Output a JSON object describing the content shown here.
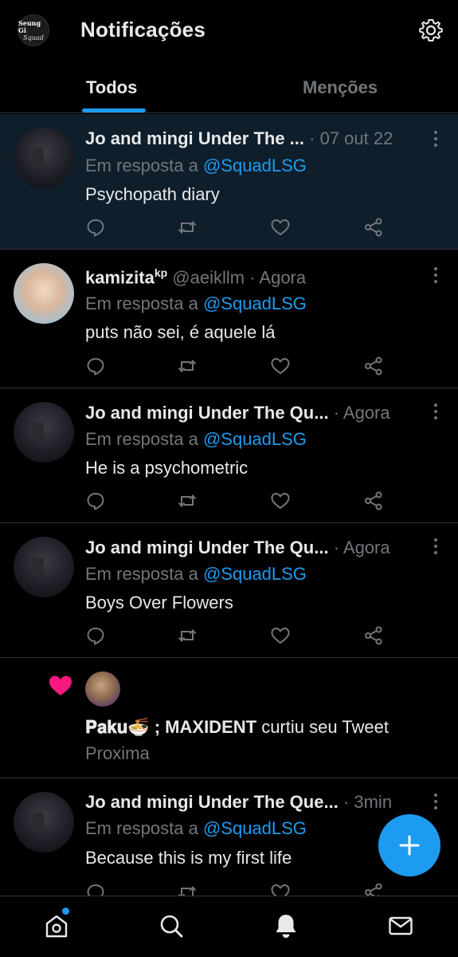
{
  "header": {
    "title": "Notificações",
    "avatar_line1": "Seung Gi",
    "avatar_line2": "Squad"
  },
  "tabs": [
    {
      "label": "Todos",
      "active": true
    },
    {
      "label": "Menções",
      "active": false
    }
  ],
  "notifications": [
    {
      "type": "reply",
      "name": "Jo and mingi Under The ...",
      "meta": " · 07 out 22",
      "reply_prefix": "Em resposta a ",
      "reply_handle": "@SquadLSG",
      "text": "Psychopath diary"
    },
    {
      "type": "reply",
      "name": "kamizita",
      "name_sup": "kp",
      "meta": " @aeikllm · Agora",
      "reply_prefix": "Em resposta a ",
      "reply_handle": "@SquadLSG",
      "text": "puts não sei, é aquele lá"
    },
    {
      "type": "reply",
      "name": "Jo and mingi Under The Qu...",
      "meta": " · Agora",
      "reply_prefix": "Em resposta a ",
      "reply_handle": "@SquadLSG",
      "text": "He is a psychometric"
    },
    {
      "type": "reply",
      "name": "Jo and mingi Under The Qu...",
      "meta": " · Agora",
      "reply_prefix": "Em resposta a ",
      "reply_handle": "@SquadLSG",
      "text": "Boys Over Flowers"
    },
    {
      "type": "like",
      "name": "𝐏𝐚𝐤𝐮🍜 ; MAXIDENT",
      "action": " curtiu seu Tweet",
      "sub": "Proxima"
    },
    {
      "type": "reply",
      "name": "Jo and mingi Under The Que...",
      "meta": " · 3min",
      "reply_prefix": "Em resposta a ",
      "reply_handle": "@SquadLSG",
      "text": "Because this is my first life"
    }
  ],
  "colors": {
    "accent": "#1d9bf0",
    "heart": "#f91880",
    "muted": "#71767b",
    "text": "#e7e9ea",
    "highlight_bg": "#0f1e2b"
  },
  "icons": [
    "gear-icon",
    "reply-icon",
    "retweet-icon",
    "like-icon",
    "share-icon",
    "more-icon",
    "heart-icon",
    "plus-icon",
    "home-icon",
    "search-icon",
    "bell-icon",
    "mail-icon"
  ]
}
